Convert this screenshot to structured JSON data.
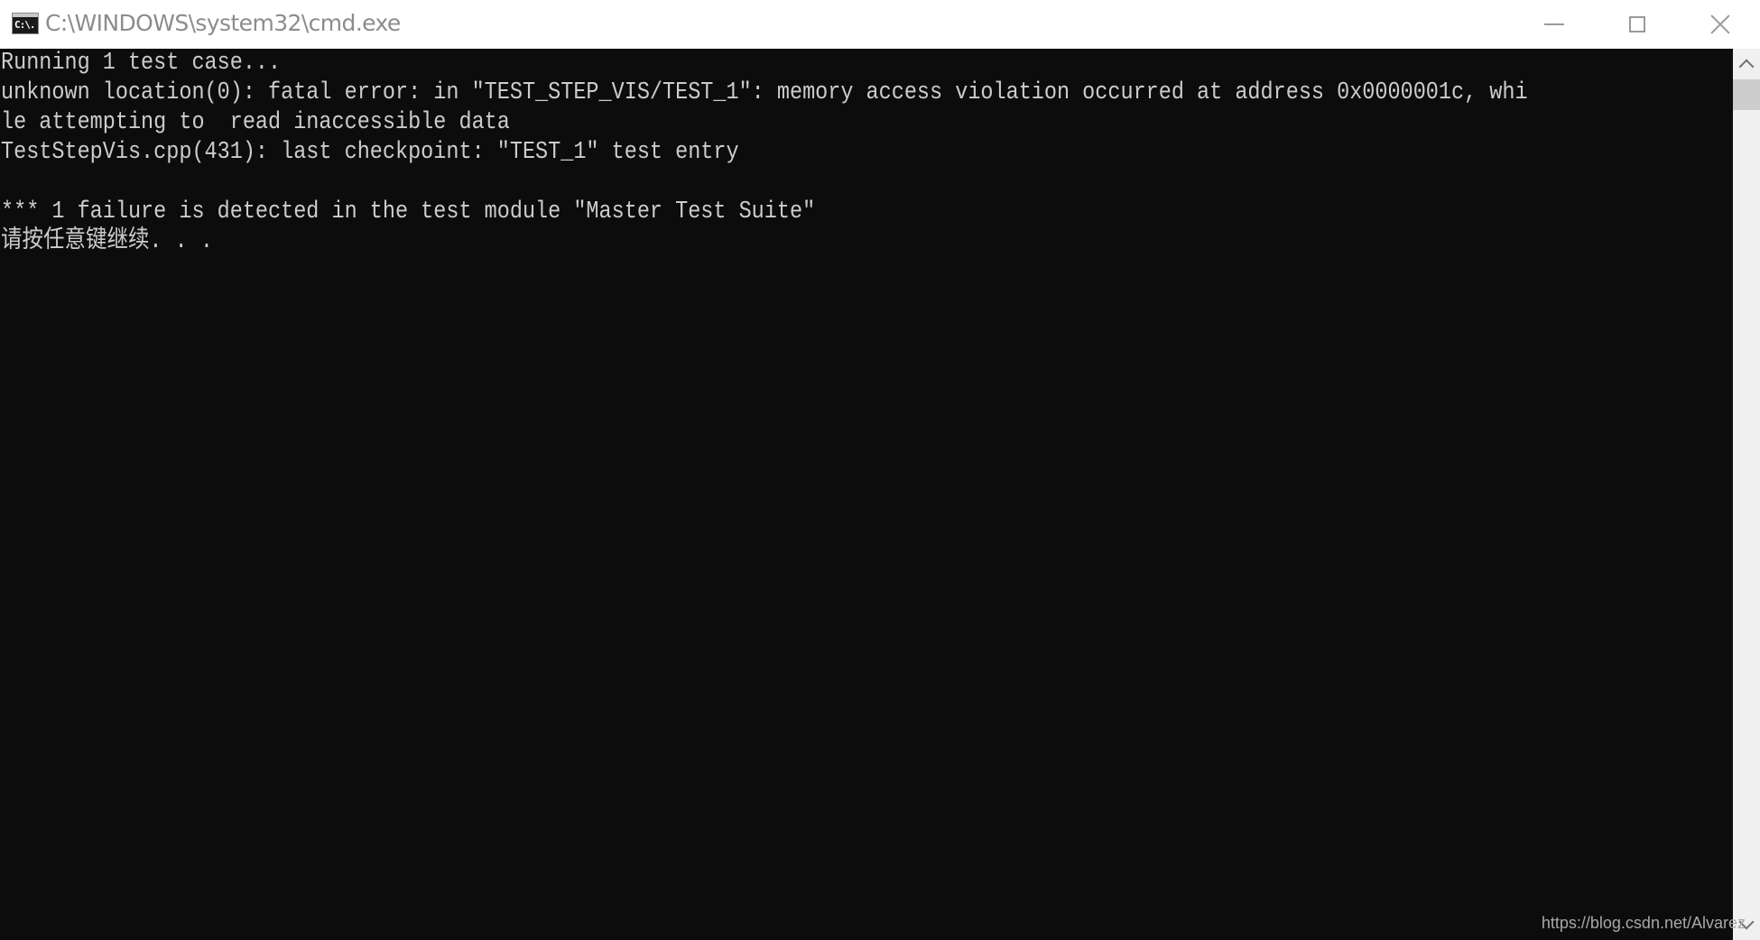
{
  "window": {
    "title": "C:\\WINDOWS\\system32\\cmd.exe",
    "icon": "cmd-icon",
    "icon_glyph": "C:\\.",
    "controls": {
      "minimize": "minimize-icon",
      "maximize": "maximize-icon",
      "close": "close-icon"
    }
  },
  "console": {
    "background": "#0c0c0c",
    "foreground": "#cccccc",
    "lines": [
      "Running 1 test case...",
      "unknown location(0): fatal error: in ″TEST_STEP_VIS/TEST_1″: memory access violation occurred at address 0x0000001c, whi",
      "le attempting to  read inaccessible data",
      "TestStepVis.cpp(431): last checkpoint: ″TEST_1″ test entry",
      "",
      "*** 1 failure is detected in the test module ″Master Test Suite″",
      "请按任意键继续. . ."
    ]
  },
  "scrollbar": {
    "up": "chevron-up-icon",
    "down": "chevron-down-icon"
  },
  "watermark": "https://blog.csdn.net/Alvarez"
}
